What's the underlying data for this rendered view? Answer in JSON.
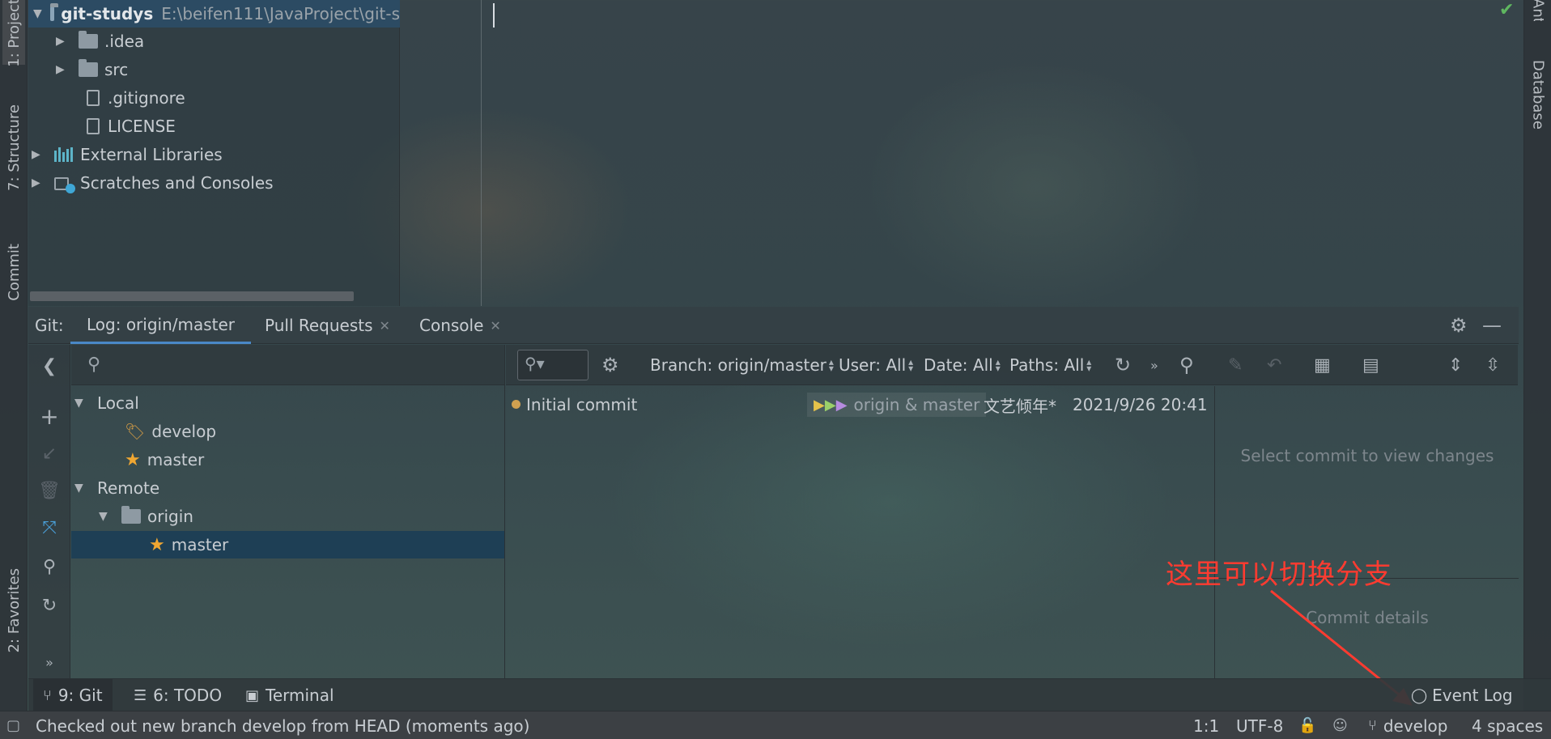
{
  "side_tabs": {
    "project": "1: Project",
    "structure": "7: Structure",
    "commit": "Commit",
    "favorites": "2: Favorites",
    "ant": "Ant",
    "database": "Database"
  },
  "project_tree": {
    "root_name": "git-studys",
    "root_path": "E:\\beifen111\\JavaProject\\git-s",
    "items": [
      {
        "label": ".idea",
        "kind": "folder"
      },
      {
        "label": "src",
        "kind": "folder"
      },
      {
        "label": ".gitignore",
        "kind": "file"
      },
      {
        "label": "LICENSE",
        "kind": "file"
      },
      {
        "label": "External Libraries",
        "kind": "library"
      },
      {
        "label": "Scratches and Consoles",
        "kind": "scratches"
      }
    ]
  },
  "git_window": {
    "prefix": "Git:",
    "tabs": [
      {
        "label": "Log: origin/master",
        "closable": false,
        "active": true
      },
      {
        "label": "Pull Requests",
        "closable": true
      },
      {
        "label": "Console",
        "closable": true
      }
    ]
  },
  "branches": {
    "local_label": "Local",
    "local": [
      {
        "name": "develop",
        "icon": "tag-icon"
      },
      {
        "name": "master",
        "icon": "star-icon"
      }
    ],
    "remote_label": "Remote",
    "remote_group": "origin",
    "remote": [
      {
        "name": "master",
        "icon": "star-icon",
        "selected": true
      }
    ]
  },
  "log_filters": {
    "branch": "Branch: origin/master",
    "user": "User: All",
    "date": "Date: All",
    "paths": "Paths: All"
  },
  "commits": [
    {
      "message": "Initial commit",
      "refs": "origin & master",
      "author": "文艺倾年*",
      "date": "2021/9/26 20:41"
    }
  ],
  "details": {
    "changes_placeholder": "Select commit to view changes",
    "details_placeholder": "Commit details"
  },
  "bottom_tabs": [
    {
      "label": "9: Git",
      "icon": "branch-icon",
      "active": true
    },
    {
      "label": "6: TODO",
      "icon": "list-icon"
    },
    {
      "label": "Terminal",
      "icon": "terminal-icon"
    }
  ],
  "event_log": "Event Log",
  "status": {
    "message": "Checked out new branch develop from HEAD (moments ago)",
    "position": "1:1",
    "encoding": "UTF-8",
    "branch": "develop",
    "indent": "4 spaces"
  },
  "annotation": "这里可以切换分支",
  "colors": {
    "accent_selection": "#1e3f55",
    "annotation": "#ff3b30",
    "star": "#f0a732"
  }
}
